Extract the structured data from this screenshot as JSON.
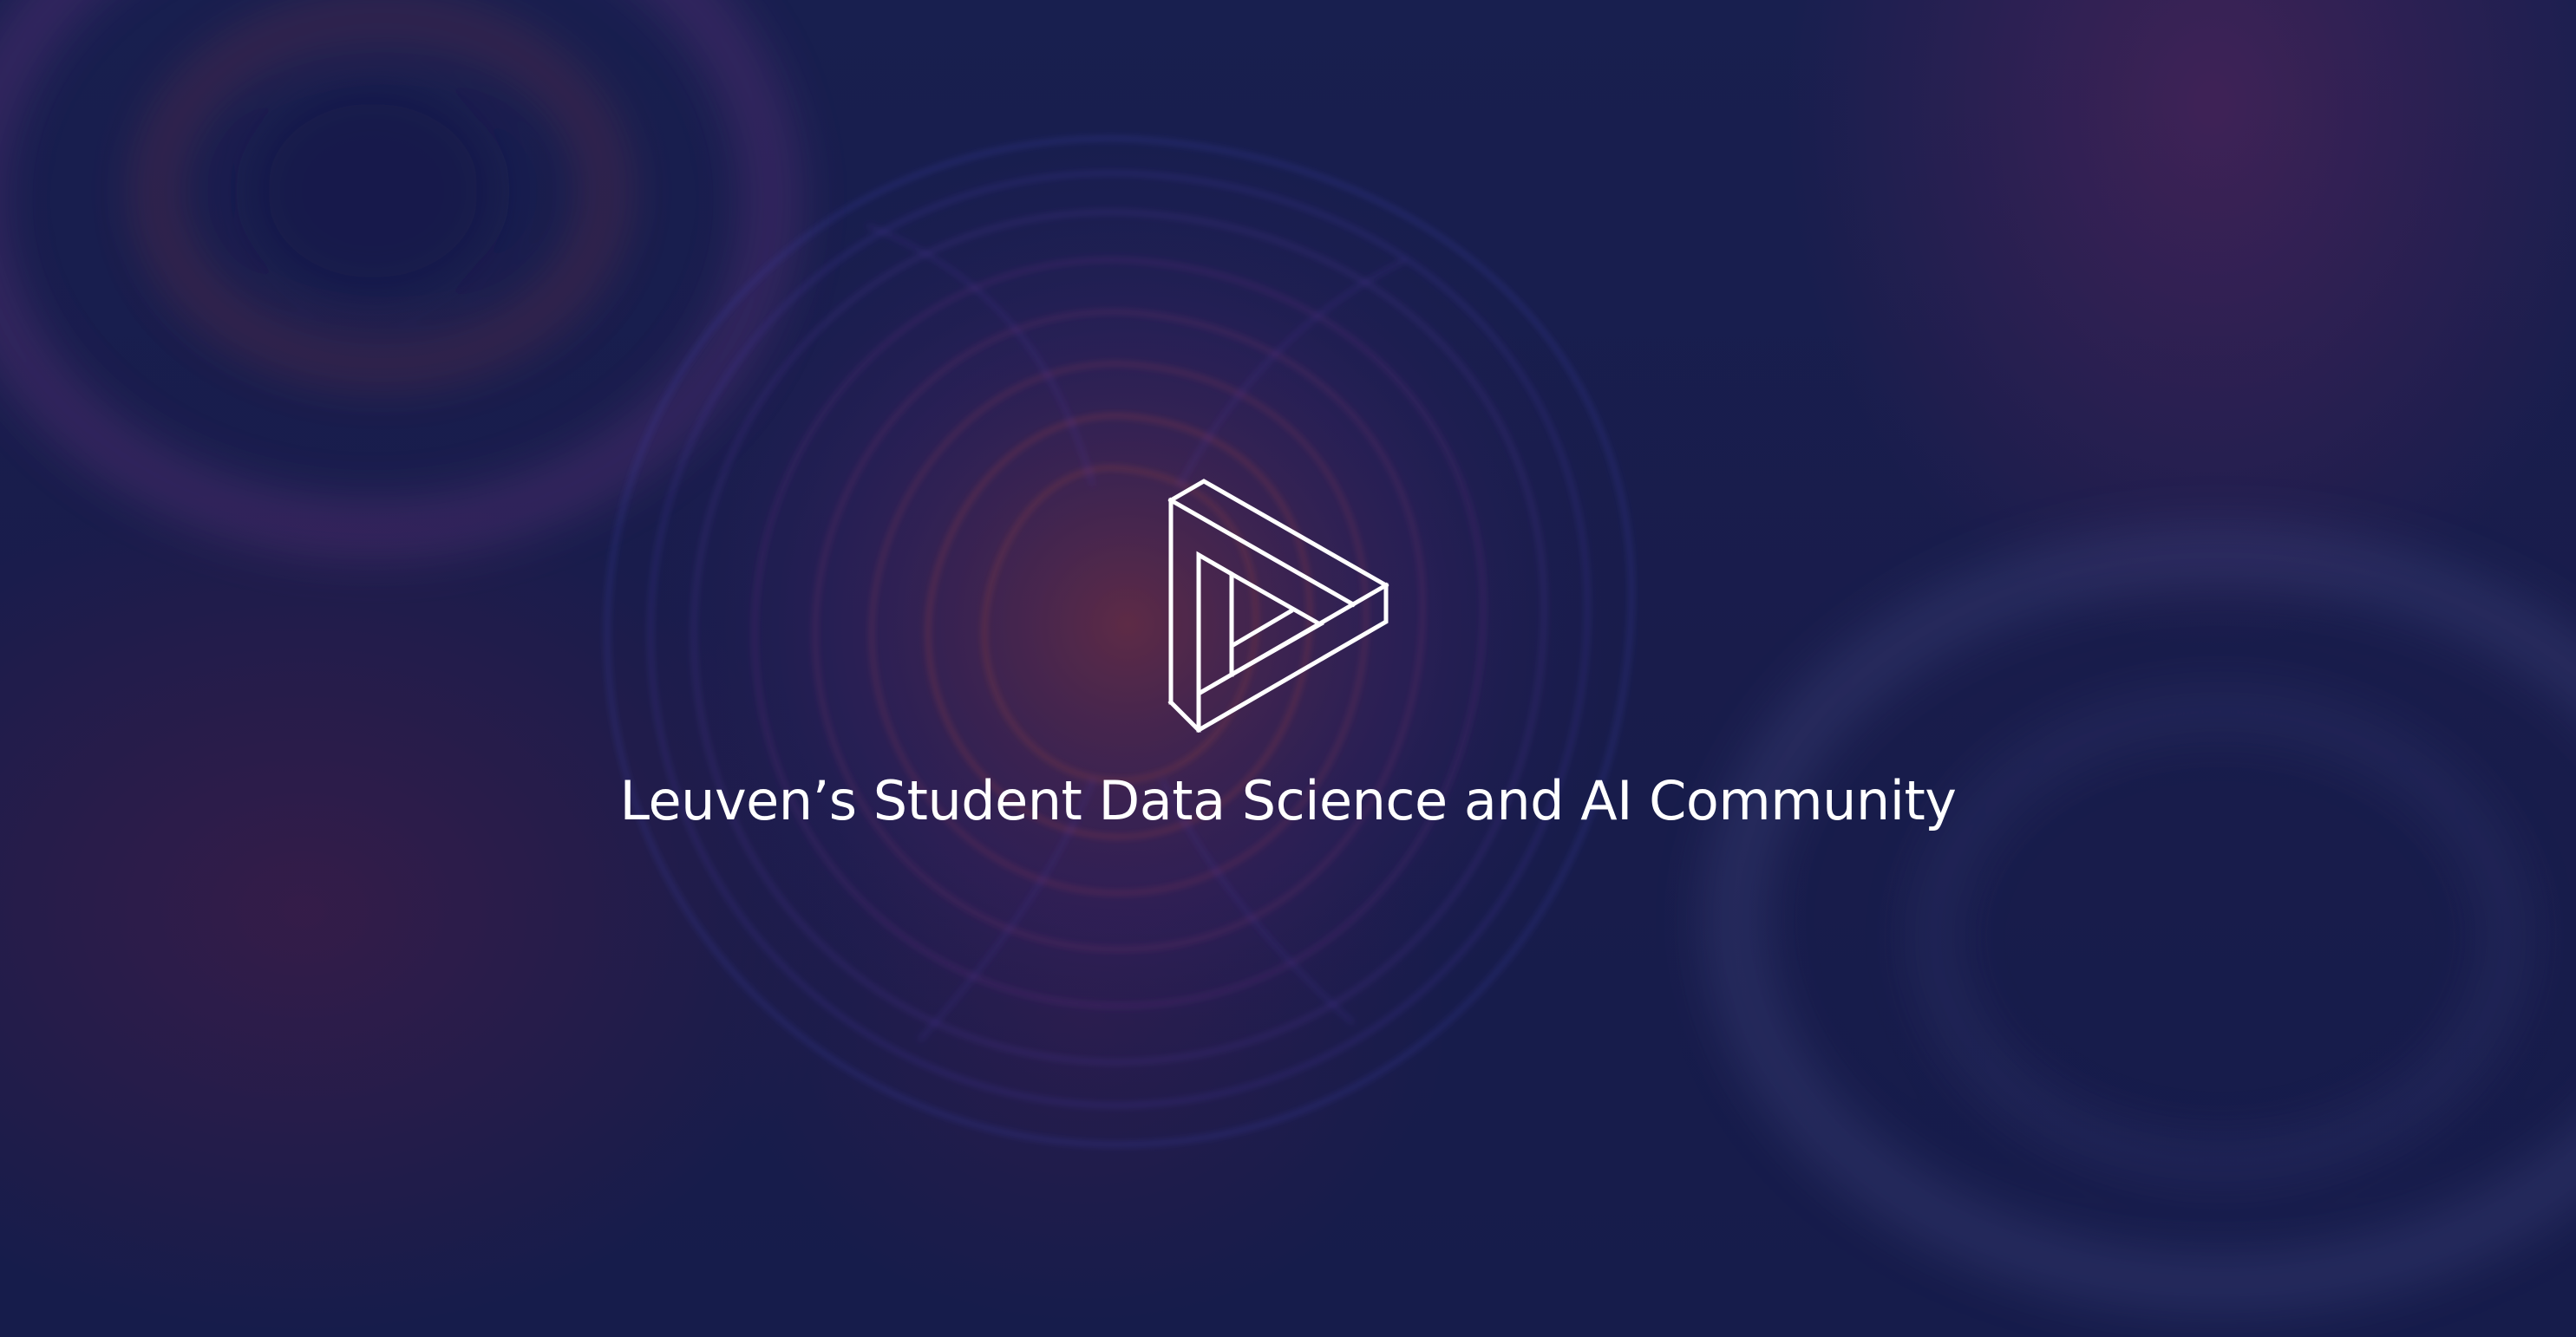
{
  "hero": {
    "tagline": "Leuven’s Student Data Science and AI Community",
    "logo_icon": "penrose-triangle-play-icon"
  },
  "colors": {
    "background_dark": "#171d4a",
    "text": "#ffffff",
    "accent_orange": "#e0553a",
    "accent_purple": "#5a3fd0",
    "accent_magenta": "#7a2e6e"
  }
}
